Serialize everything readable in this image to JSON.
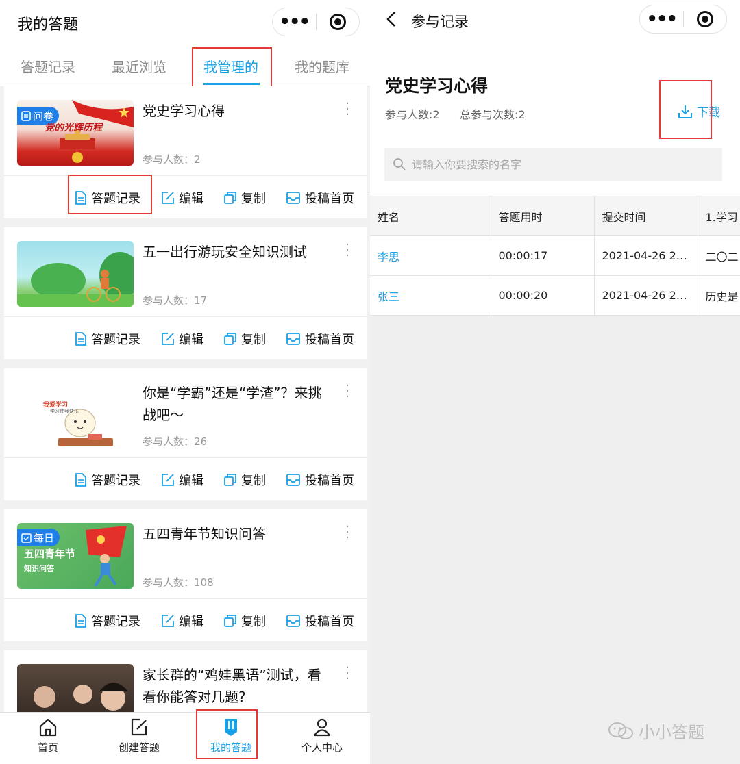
{
  "left": {
    "header": {
      "title": "我的答题"
    },
    "tabs": [
      "答题记录",
      "最近浏览",
      "我管理的",
      "我的题库"
    ],
    "active_tab": "我管理的",
    "cards": [
      {
        "title": "党史学习心得",
        "count_label": "参与人数：2",
        "badge": "问卷",
        "thumb_caption": "党的光辉历程"
      },
      {
        "title": "五一出行游玩安全知识测试",
        "count_label": "参与人数：17"
      },
      {
        "title": "你是“学霸”还是“学渣”？来挑战吧～",
        "count_label": "参与人数：26",
        "thumb_caption_1": "我爱学习",
        "thumb_caption_2": "学习使我快乐"
      },
      {
        "title": "五四青年节知识问答",
        "count_label": "参与人数：108",
        "badge": "每日",
        "thumb_caption_1": "五四青年节",
        "thumb_caption_2": "知识问答"
      },
      {
        "title": "家长群的“鸡娃黑语”测试，看看你能答对几题?"
      }
    ],
    "actions": {
      "records": "答题记录",
      "edit": "编辑",
      "copy": "复制",
      "publish": "投稿首页"
    },
    "bottom_nav": [
      {
        "label": "首页",
        "icon": "home-icon"
      },
      {
        "label": "创建答题",
        "icon": "edit-icon"
      },
      {
        "label": "我的答题",
        "icon": "bookmark-icon"
      },
      {
        "label": "个人中心",
        "icon": "user-icon"
      }
    ],
    "active_nav": "我的答题"
  },
  "right": {
    "nav_title": "参与记录",
    "title": "党史学习心得",
    "participants": "参与人数:2",
    "total": "总参与次数:2",
    "download": "下载",
    "search_placeholder": "请输入你要搜索的名字",
    "table": {
      "headers": [
        "姓名",
        "答题用时",
        "提交时间",
        "1.学习"
      ],
      "rows": [
        [
          "李思",
          "00:00:17",
          "2021-04-26 2…",
          "二〇二"
        ],
        [
          "张三",
          "00:00:20",
          "2021-04-26 2…",
          "历史是"
        ]
      ]
    }
  },
  "watermark": "小小答题",
  "colors": {
    "accent": "#1aa0e6",
    "highlight_box": "#e53935"
  }
}
